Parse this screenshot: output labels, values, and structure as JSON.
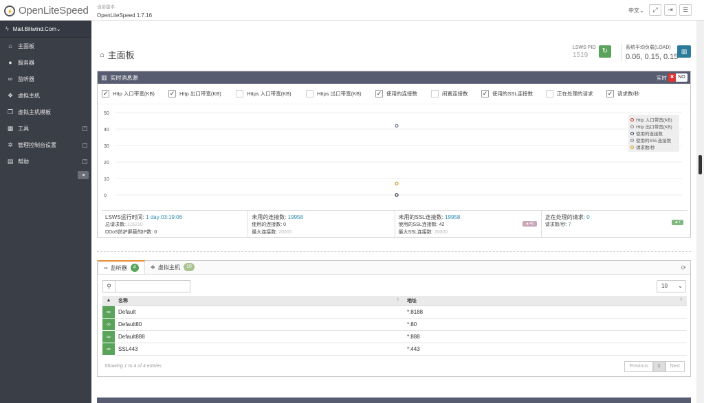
{
  "app": {
    "name": "OpenLiteSpeed",
    "version_label": "当前版本:",
    "version": "OpenLiteSpeed 1.7.16"
  },
  "header": {
    "language": "中文",
    "lang_caret": "⌄"
  },
  "sidebar": {
    "server": "Mail.Biliwind.Com",
    "items": [
      {
        "label": "主面板",
        "icon": "home-icon"
      },
      {
        "label": "服务器",
        "icon": "globe-icon"
      },
      {
        "label": "监听器",
        "icon": "link-icon"
      },
      {
        "label": "虚拟主机",
        "icon": "cubes-icon"
      },
      {
        "label": "虚拟主机模板",
        "icon": "copy-icon"
      },
      {
        "label": "工具",
        "icon": "grid-icon"
      },
      {
        "label": "管理控制台设置",
        "icon": "gear-icon"
      },
      {
        "label": "帮助",
        "icon": "book-icon"
      }
    ]
  },
  "page": {
    "title": "主面板",
    "pid_label": "LSWS PID",
    "pid": "1519",
    "load_label": "系统平均负载(LOAD)",
    "load": "0.06, 0.15, 0.15"
  },
  "realtime": {
    "title": "实时消息源",
    "realtime_label": "实时",
    "toggle_value": "NO",
    "checkboxes": [
      {
        "label": "Http 入口带宽(KB)",
        "checked": true
      },
      {
        "label": "Http 出口带宽(KB)",
        "checked": true
      },
      {
        "label": "Https 入口带宽(KB)",
        "checked": false
      },
      {
        "label": "Https 出口带宽(KB)",
        "checked": false
      },
      {
        "label": "使用的连接数",
        "checked": true
      },
      {
        "label": "闲置连接数",
        "checked": false
      },
      {
        "label": "使用的SSL连接数",
        "checked": true
      },
      {
        "label": "正在处理的请求",
        "checked": false
      },
      {
        "label": "请求数/秒",
        "checked": true
      }
    ],
    "stats": [
      {
        "r1_label": "LSWS运行时间: ",
        "r1_value": "1 day 03:19:06",
        "r2_label": "总请求数: ",
        "r2_value": "116210",
        "r3_label": "DDoS防护屏蔽的IP数: ",
        "r3_value": "0"
      },
      {
        "r1_label": "未用的连接数: ",
        "r1_value": "19958",
        "r2_label": "使用的连接数: ",
        "r2_value": "0",
        "r3_label": "最大连接数: ",
        "r3_value": "20000"
      },
      {
        "r1_label": "未用的SSL连接数: ",
        "r1_value": "19958",
        "r2_label": "使用的SSL连接数: ",
        "r2_value": "42",
        "r3_label": "最大SSL连接数: ",
        "r3_value": "20000",
        "badge": "▲42"
      },
      {
        "r1_label": "正在处理的请求: ",
        "r1_value": "0",
        "r2_label": "请求数/秒: ",
        "r2_value": "7",
        "badge": "▲7"
      }
    ]
  },
  "chart_data": {
    "type": "scatter",
    "ylim": [
      0,
      50
    ],
    "yticks": [
      "50",
      "40",
      "30",
      "20",
      "10",
      "0"
    ],
    "series": [
      {
        "name": "Http 入口带宽(KB)",
        "color": "#c0392b",
        "values": [
          0
        ]
      },
      {
        "name": "Http 出口带宽(KB)",
        "color": "#888888",
        "values": [
          0
        ]
      },
      {
        "name": "使用的连接数",
        "color": "#2c3e50",
        "values": [
          0
        ]
      },
      {
        "name": "使用的SSL连接数",
        "color": "#6a7a8a",
        "values": [
          42
        ]
      },
      {
        "name": "请求数/秒",
        "color": "#c8a020",
        "values": [
          7
        ]
      }
    ]
  },
  "listeners": {
    "tab_listeners": "监听器",
    "listener_count": "4",
    "tab_vhosts": "虚拟主机",
    "vhost_count": "10",
    "page_size": "10",
    "col_name": "名称",
    "col_address": "地址",
    "rows": [
      {
        "name": "Default",
        "address": "*:8188"
      },
      {
        "name": "Default80",
        "address": "*:80"
      },
      {
        "name": "Default888",
        "address": "*:888"
      },
      {
        "name": "SSL443",
        "address": "*:443"
      }
    ],
    "showing": "Showing 1 to 4 of 4 entries",
    "prev": "Previous",
    "page": "1",
    "next": "Next"
  }
}
